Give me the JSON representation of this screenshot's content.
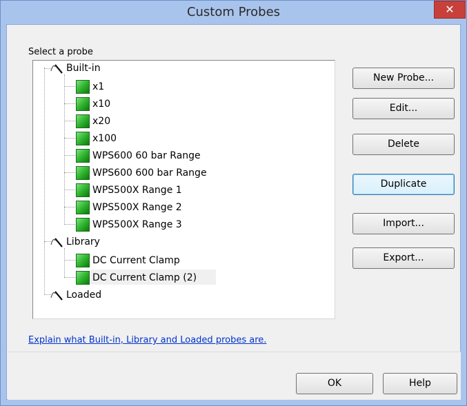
{
  "window": {
    "title": "Custom Probes",
    "close_symbol": "✕"
  },
  "probe_group": {
    "label": "Select a probe"
  },
  "tree": {
    "built_in": {
      "label": "Built-in",
      "icon": "probe-tip-icon",
      "children": [
        "x1",
        "x10",
        "x20",
        "x100",
        "WPS600 60 bar Range",
        "WPS600 600 bar Range",
        "WPS500X Range 1",
        "WPS500X Range 2",
        "WPS500X Range 3"
      ]
    },
    "library": {
      "label": "Library",
      "icon": "probe-tip-icon",
      "children": [
        "DC Current Clamp",
        "DC Current Clamp (2)"
      ]
    },
    "loaded": {
      "label": "Loaded",
      "icon": "probe-tip-icon"
    },
    "selected_item": "DC Current Clamp (2)",
    "probe_icon_color": "#2fb52f"
  },
  "buttons": {
    "new_probe": "New Probe...",
    "edit": "Edit...",
    "delete": "Delete",
    "duplicate": "Duplicate",
    "import": "Import...",
    "export": "Export..."
  },
  "help_link": "Explain what Built-in, Library and Loaded probes are.",
  "footer": {
    "ok": "OK",
    "help": "Help"
  },
  "colors": {
    "titlebar": "#a9c4ec",
    "close_button": "#c7413a",
    "link": "#0033cc"
  }
}
